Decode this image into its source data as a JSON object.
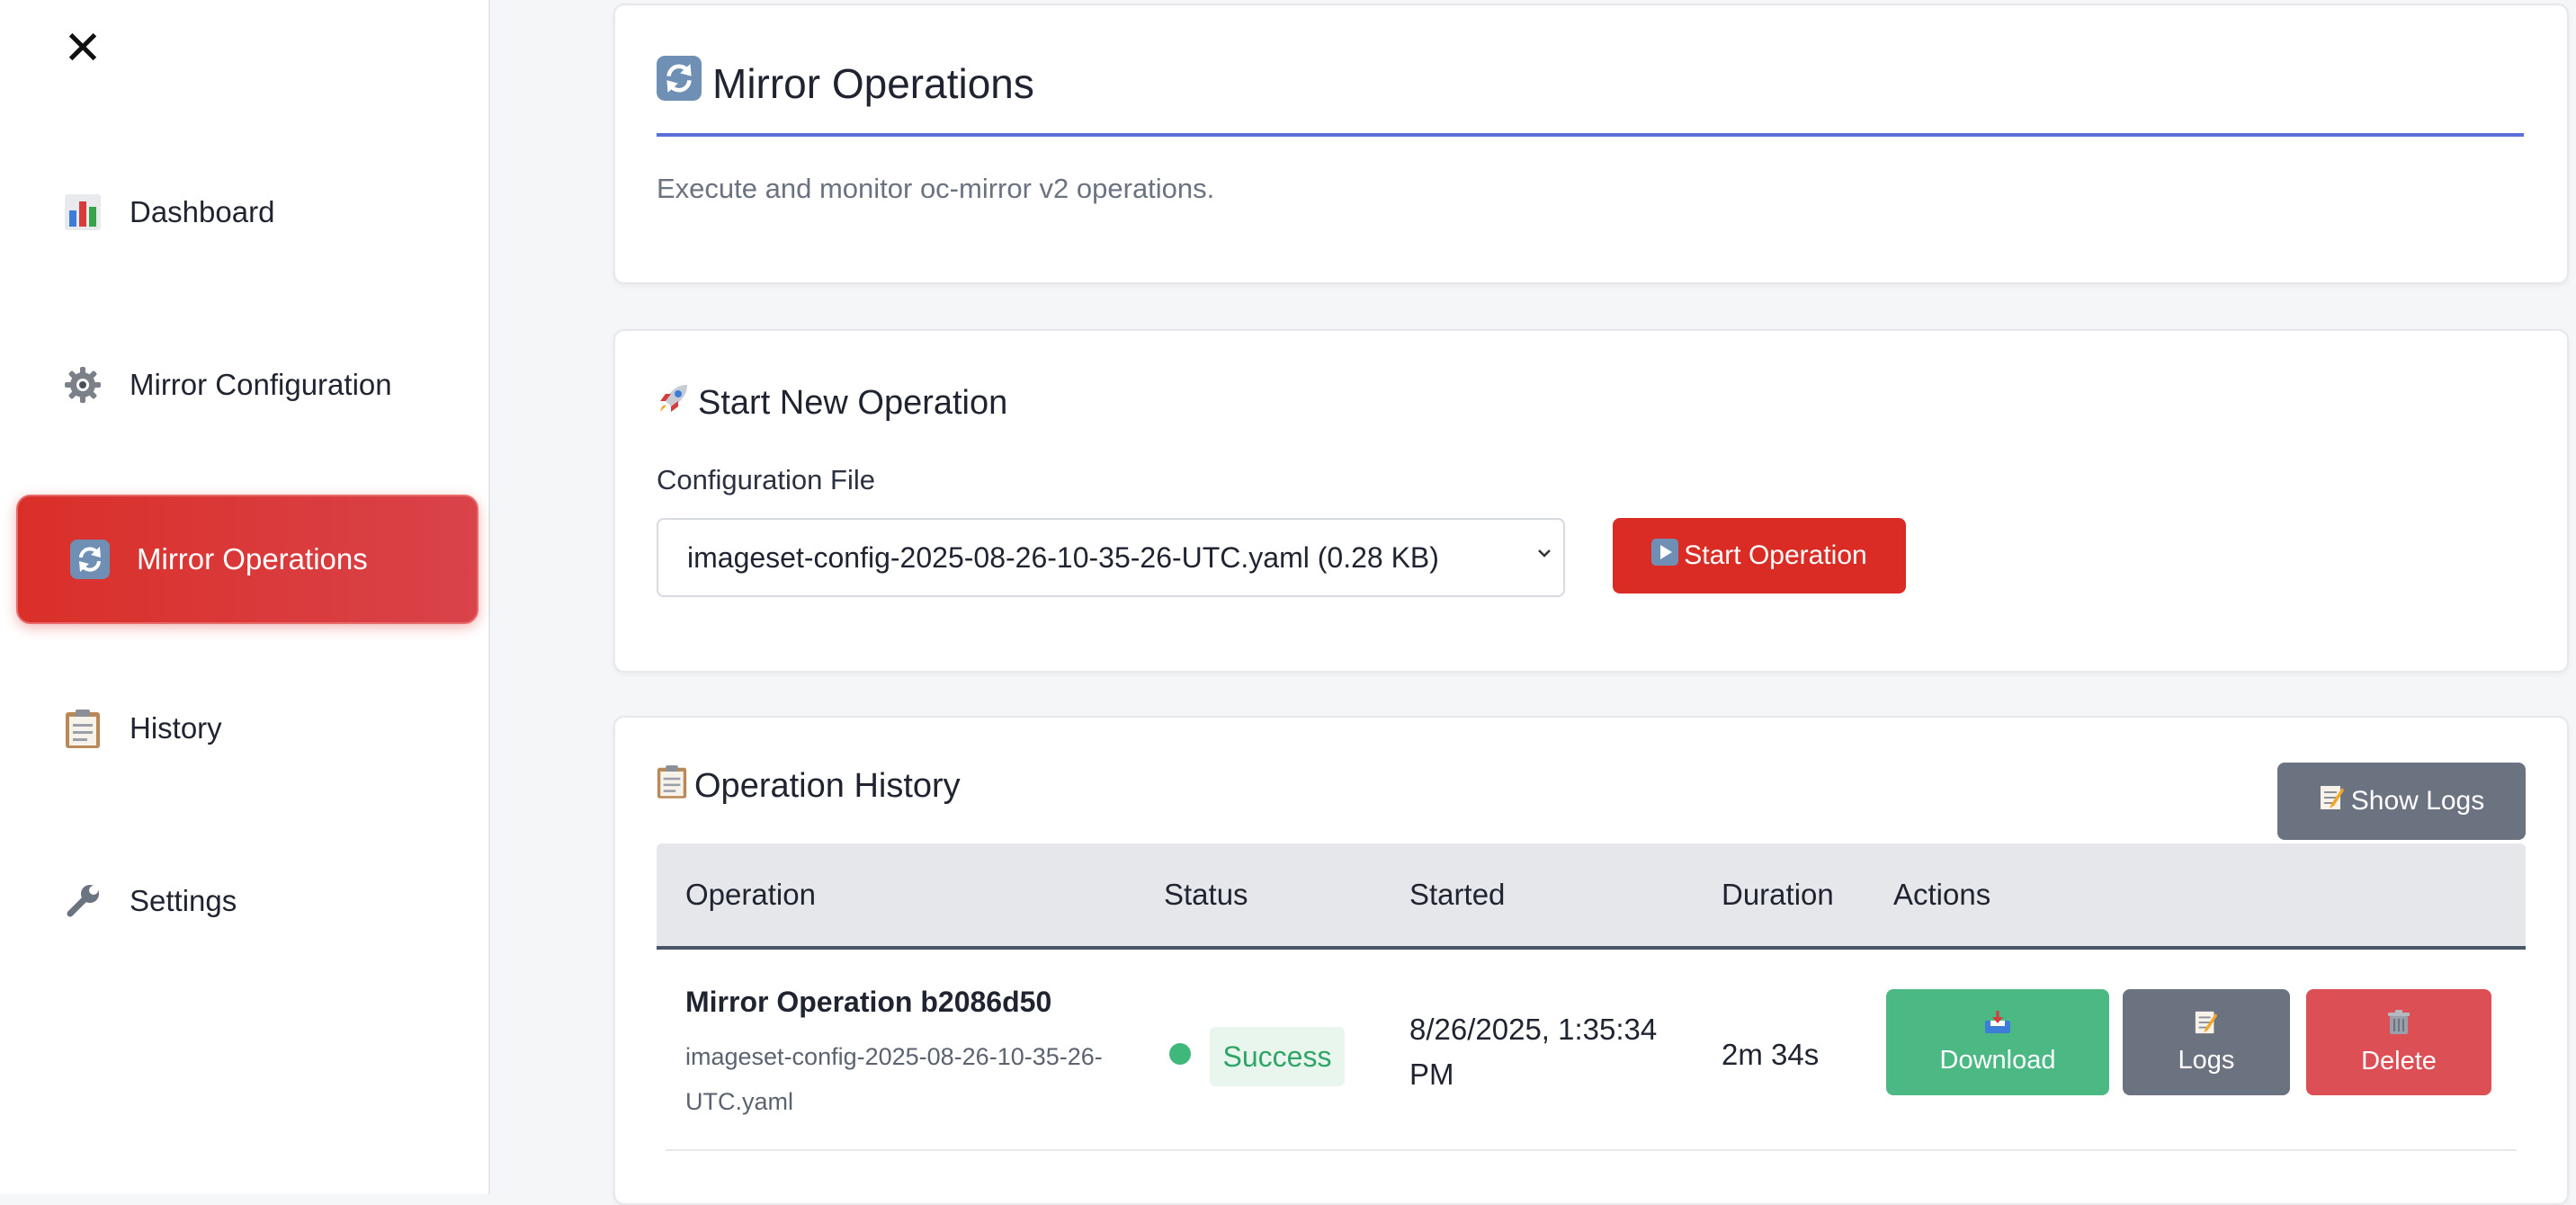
{
  "sidebar": {
    "close_label": "✕",
    "items": [
      {
        "label": "Dashboard",
        "icon": "bar-chart-icon",
        "active": false
      },
      {
        "label": "Mirror Configuration",
        "icon": "gear-icon",
        "active": false
      },
      {
        "label": "Mirror Operations",
        "icon": "refresh-icon",
        "active": true
      },
      {
        "label": "History",
        "icon": "clipboard-icon",
        "active": false
      },
      {
        "label": "Settings",
        "icon": "wrench-icon",
        "active": false
      }
    ]
  },
  "header": {
    "title": "Mirror Operations",
    "description": "Execute and monitor oc-mirror v2 operations."
  },
  "start_operation": {
    "title": "Start New Operation",
    "config_label": "Configuration File",
    "selected_config": "imageset-config-2025-08-26-10-35-26-UTC.yaml (0.28 KB)",
    "start_button": "Start Operation"
  },
  "history": {
    "title": "Operation History",
    "show_logs_button": "Show Logs",
    "columns": [
      "Operation",
      "Status",
      "Started",
      "Duration",
      "Actions"
    ],
    "rows": [
      {
        "name": "Mirror Operation b2086d50",
        "config_file": "imageset-config-2025-08-26-10-35-26-UTC.yaml",
        "status": "Success",
        "started": "8/26/2025, 1:35:34 PM",
        "duration": "2m 34s",
        "actions": {
          "download": "Download",
          "logs": "Logs",
          "delete": "Delete"
        }
      }
    ]
  },
  "colors": {
    "accent_red": "#da2c24",
    "rule_blue": "#5b6fd8",
    "success_green": "#4cb984",
    "neutral_gray": "#6b7280",
    "danger_red": "#dc4f54"
  }
}
